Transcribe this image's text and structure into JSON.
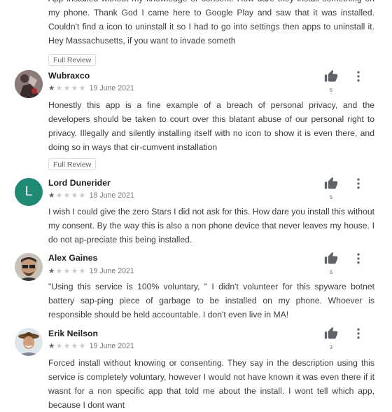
{
  "reviews": [
    {
      "text": "App installed without my knowledge or consent. How dare they install something on my phone. Thank God I came here to Google Play and saw that it was installed. Couldn't find a icon to uninstall it so I had to go into settings then apps to uninstall it. Hey Massachusetts, if you want to invade someth",
      "full_review_label": "Full Review"
    },
    {
      "author": "Wubraxco",
      "rating": 1,
      "date": "19 June 2021",
      "helpful_count": "5",
      "text": "Honestly this app is a fine example of a breach of personal privacy, and the developers should be taken to court over this blatant abuse of our personal right to privacy. Illegally and silently installing itself with no icon to show it is even there, and doing so in ways that cir-cumvent installation",
      "full_review_label": "Full Review"
    },
    {
      "author": "Lord Dunerider",
      "avatar_letter": "L",
      "rating": 1,
      "date": "18 June 2021",
      "helpful_count": "5",
      "text": "I wish I could give the zero Stars I did not ask for this. How dare you install this without my consent. By the way this is also a non phone device that never leaves my house. I do not ap-preciate this being installed."
    },
    {
      "author": "Alex Gaines",
      "rating": 1,
      "date": "19 June 2021",
      "helpful_count": "6",
      "text": "\"Using this service is 100% voluntary, \" I didn't volunteer for this spyware botnet battery sap-ping piece of garbage to be installed on my phone. Whoever is responsible should be held accountable. I don't even live in MA!"
    },
    {
      "author": "Erik Neilson",
      "rating": 1,
      "date": "19 June 2021",
      "helpful_count": "3",
      "text": "Forced install without knowing or consenting. They say in the description using this service is completely voluntary, however I would not have known it was even there if it wasnt for a non specific app that told me about the install. I wont tell which app, because I dont want"
    }
  ],
  "colors": {
    "avatar_green": "#1e8a74",
    "star_filled": "#5f6368",
    "star_empty": "#c7c7c7"
  },
  "icons": {
    "thumb": "thumbs-up-icon",
    "more": "more-vert-icon"
  }
}
